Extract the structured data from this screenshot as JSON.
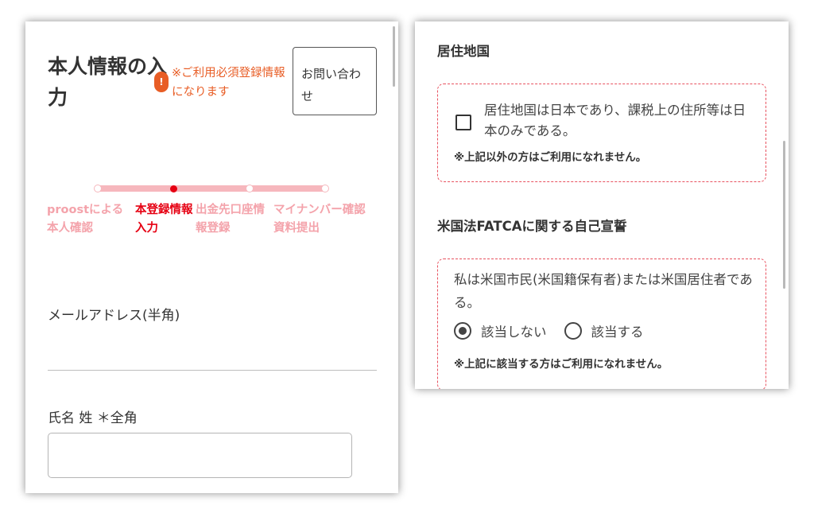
{
  "left_screen": {
    "page_title": "本人情報の入力",
    "required_note": {
      "icon": "exclamation-icon",
      "text": "※ご利用必須登録情報になります"
    },
    "contact_button": "お問い合わせ",
    "stepper": {
      "steps": [
        {
          "label": "proostによる本人確認",
          "state": "done"
        },
        {
          "label": "本登録情報入力",
          "state": "current"
        },
        {
          "label": "出金先口座情報登録",
          "state": "upcoming"
        },
        {
          "label": "マイナンバー確認資料提出",
          "state": "upcoming"
        }
      ],
      "active_color": "#e60012",
      "inactive_color": "#f4a3ab"
    },
    "email_label": "メールアドレス(半角)",
    "email_value": "",
    "name_label": "氏名 姓 ＊全角",
    "name_value": ""
  },
  "right_screen": {
    "residence": {
      "title": "居住地国",
      "statement": "居住地国は日本であり、課税上の住所等は日本のみである。",
      "checked": false,
      "note": "※上記以外の方はご利用になれません。"
    },
    "fatca": {
      "title": "米国法FATCAに関する自己宣誓",
      "statement": "私は米国市民(米国籍保有者)または米国居住者である。",
      "options": [
        {
          "label": "該当しない",
          "selected": true
        },
        {
          "label": "該当する",
          "selected": false
        }
      ],
      "note": "※上記に該当する方はご利用になれません。"
    },
    "accent_color": "#e8525f"
  }
}
